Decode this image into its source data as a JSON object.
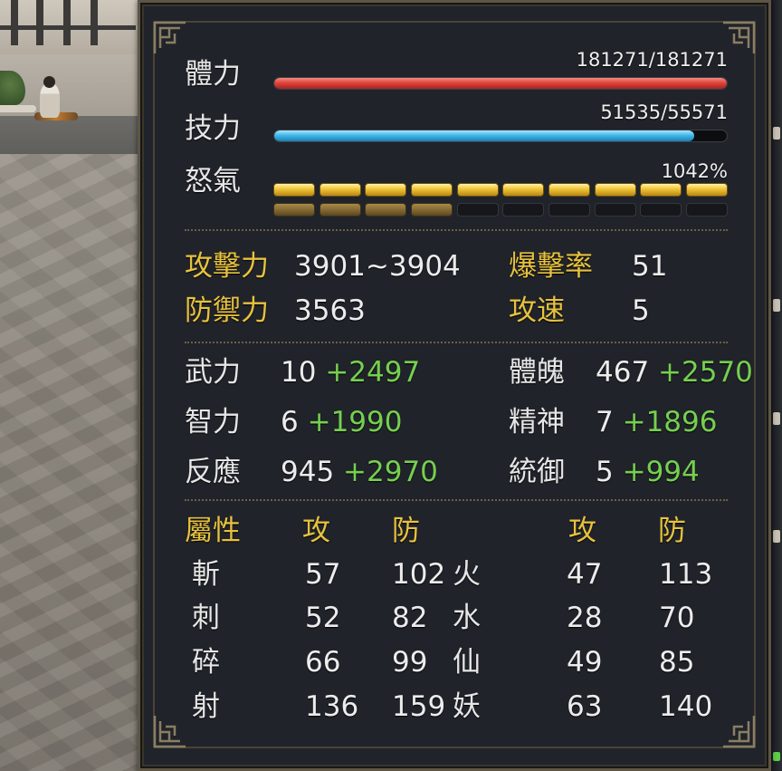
{
  "vitals": {
    "hp": {
      "label": "體力",
      "text": "181271/181271",
      "current": 181271,
      "max": 181271
    },
    "sp": {
      "label": "技力",
      "text": "51535/55571",
      "current": 51535,
      "max": 55571
    },
    "rage": {
      "label": "怒氣",
      "text": "1042%",
      "percent": 1042,
      "pips_full": 10,
      "second_row_filled": 4,
      "pips_total": 10
    }
  },
  "combat": {
    "attack": {
      "label": "攻擊力",
      "value": "3901~3904"
    },
    "crit": {
      "label": "爆擊率",
      "value": "51"
    },
    "defense": {
      "label": "防禦力",
      "value": "3563"
    },
    "speed": {
      "label": "攻速",
      "value": "5"
    }
  },
  "stats": [
    {
      "label": "武力",
      "base": "10",
      "bonus": "+2497"
    },
    {
      "label": "體魄",
      "base": "467",
      "bonus": "+2570"
    },
    {
      "label": "智力",
      "base": "6",
      "bonus": "+1990"
    },
    {
      "label": "精神",
      "base": "7",
      "bonus": "+1896"
    },
    {
      "label": "反應",
      "base": "945",
      "bonus": "+2970"
    },
    {
      "label": "統御",
      "base": "5",
      "bonus": "+994"
    }
  ],
  "attributes": {
    "header": {
      "title": "屬性",
      "atk": "攻",
      "def": "防",
      "atk2": "攻",
      "def2": "防"
    },
    "rows": [
      {
        "type1": "斬",
        "atk1": "57",
        "def1": "102",
        "type2": "火",
        "atk2": "47",
        "def2": "113"
      },
      {
        "type1": "刺",
        "atk1": "52",
        "def1": "82",
        "type2": "水",
        "atk2": "28",
        "def2": "70"
      },
      {
        "type1": "碎",
        "atk1": "66",
        "def1": "99",
        "type2": "仙",
        "atk2": "49",
        "def2": "85"
      },
      {
        "type1": "射",
        "atk1": "136",
        "def1": "159",
        "type2": "妖",
        "atk2": "63",
        "def2": "140"
      }
    ]
  },
  "colors": {
    "label_gold": "#e7c23e",
    "bonus_green": "#76cf4f",
    "hp_red": "#e0463c",
    "sp_blue": "#41b7ea",
    "rage_gold": "#f3c83a",
    "panel_bg": "#20232a"
  }
}
